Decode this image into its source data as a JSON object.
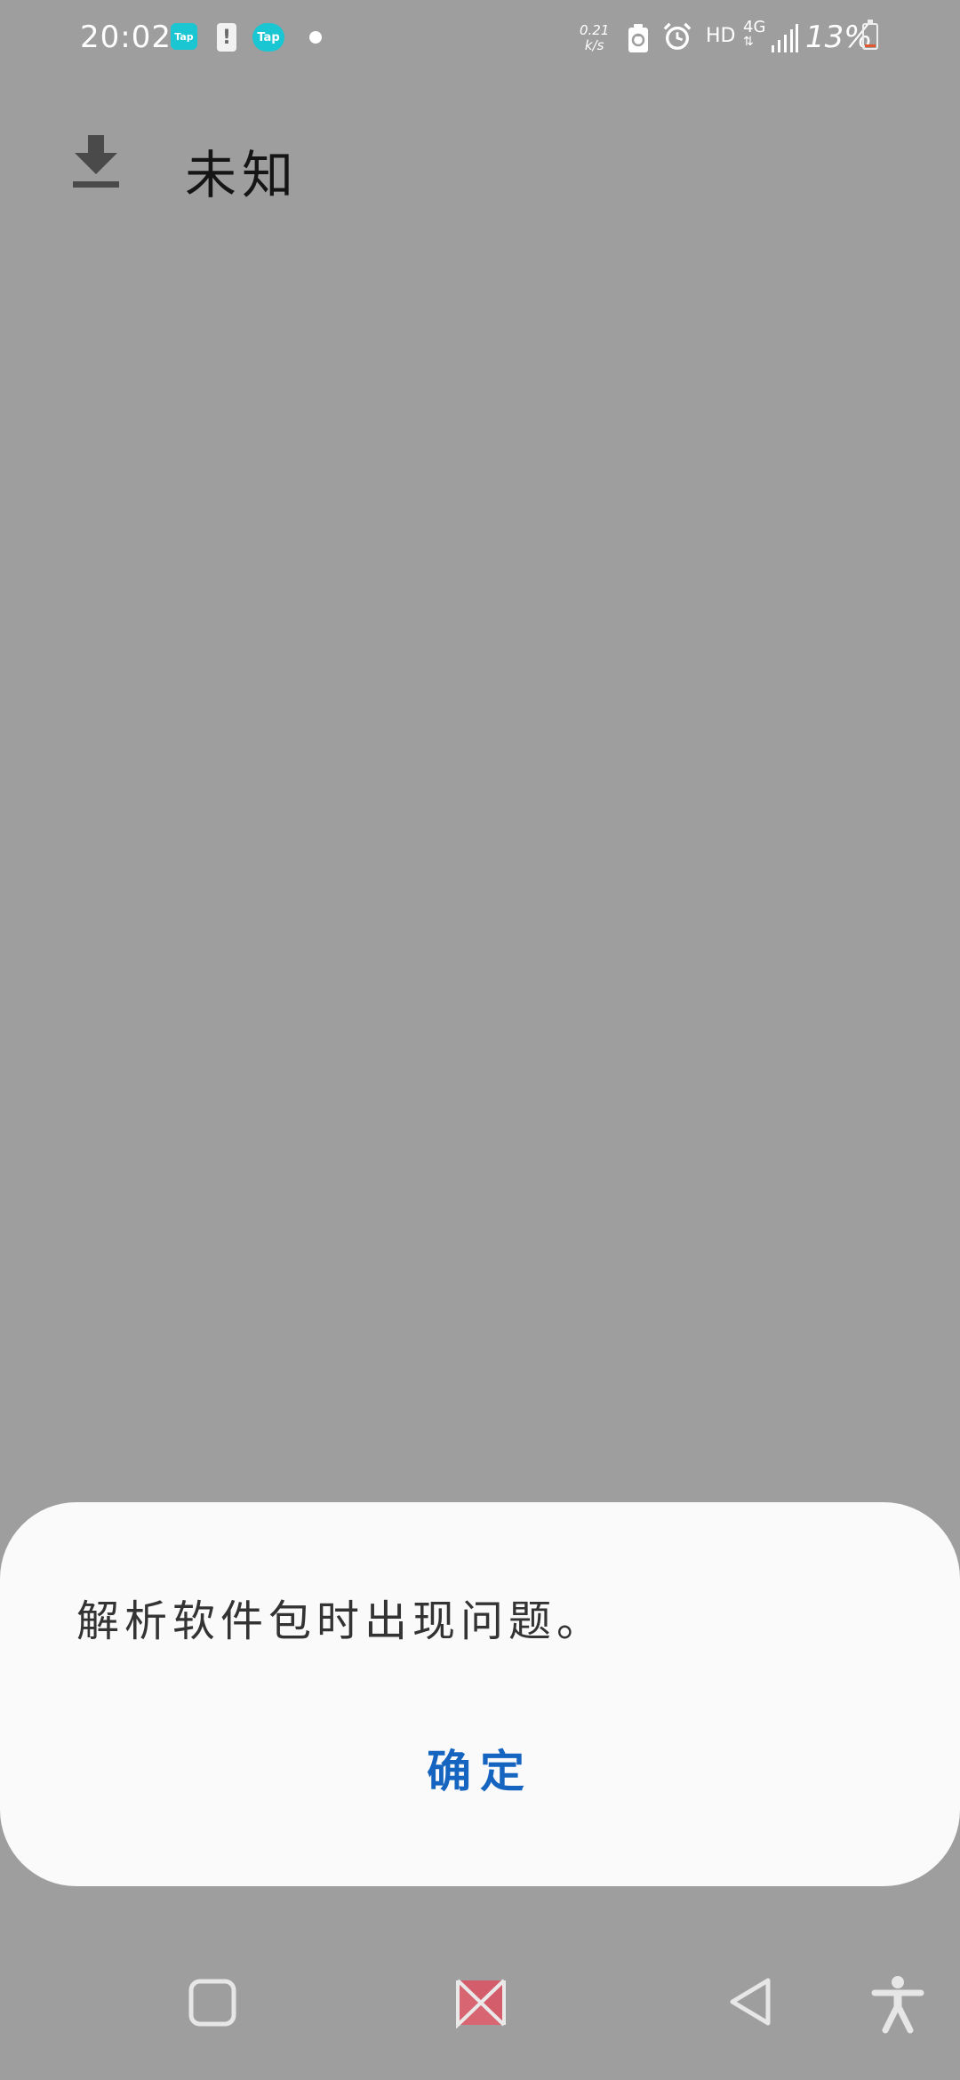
{
  "status_bar": {
    "time": "20:02",
    "tap_label_1": "Tap",
    "warning_glyph": "!",
    "tap_label_2": "Tap",
    "net_speed_value": "0.21",
    "net_speed_unit": "k/s",
    "hd_label": "HD",
    "network_type": "4G",
    "battery_percent": "13%",
    "battery_level": 0.13,
    "battery_low_color": "#e3572e",
    "icons": [
      "tap-app-icon",
      "warning-icon",
      "tap-app-icon",
      "notification-dot-icon",
      "recycle-icon",
      "alarm-icon",
      "signal-icon",
      "battery-icon"
    ]
  },
  "header": {
    "icon": "download-icon",
    "title": "未知"
  },
  "dialog": {
    "message": "解析软件包时出现问题。",
    "confirm_label": "确定",
    "accent_color": "#1565c0"
  },
  "nav_bar": {
    "buttons": [
      "recents-square-icon",
      "home-logo-icon",
      "back-triangle-icon",
      "accessibility-icon"
    ]
  }
}
